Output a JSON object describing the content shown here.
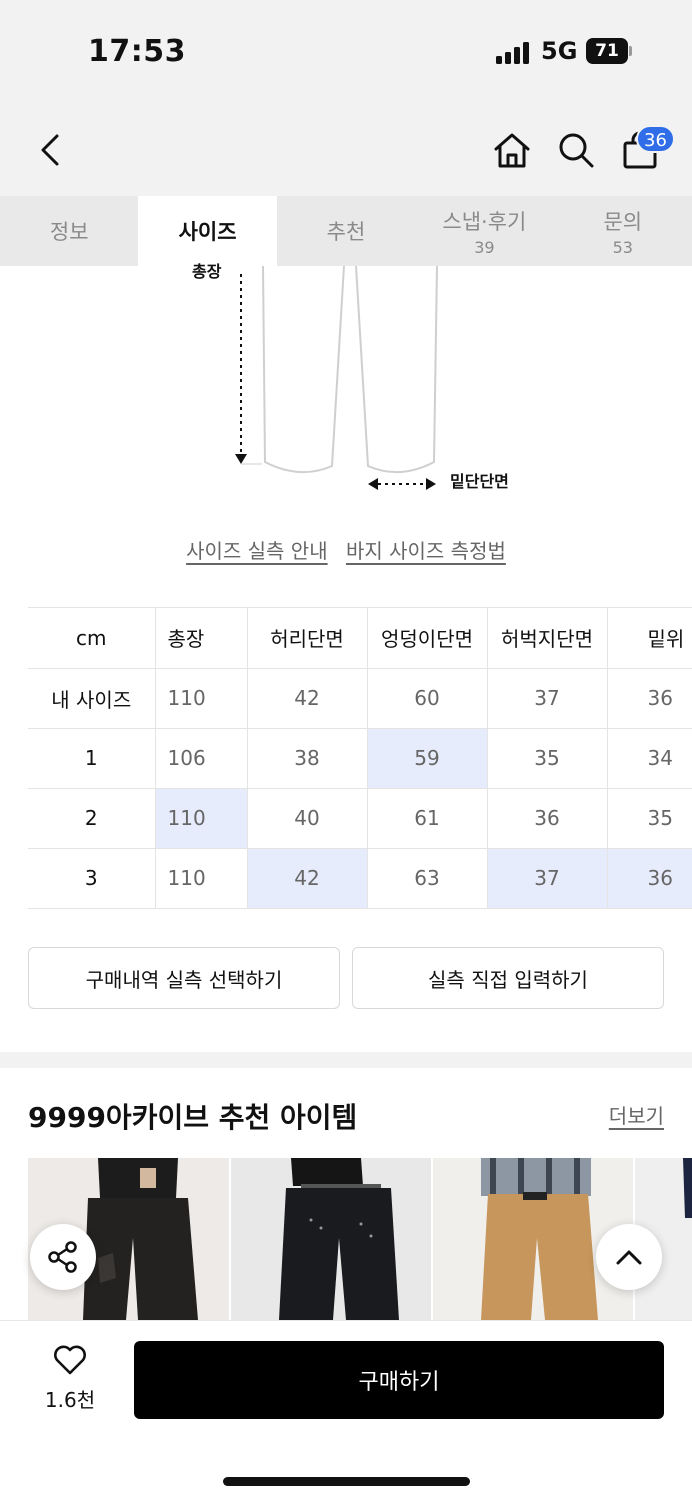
{
  "status": {
    "time": "17:53",
    "network": "5G",
    "battery": "71"
  },
  "header": {
    "cart_count": "36"
  },
  "tabs": [
    {
      "label": "정보",
      "count": ""
    },
    {
      "label": "사이즈",
      "count": ""
    },
    {
      "label": "추천",
      "count": ""
    },
    {
      "label": "스냅·후기",
      "count": "39"
    },
    {
      "label": "문의",
      "count": "53"
    }
  ],
  "diagram": {
    "length_label": "총장",
    "hem_label": "밑단단면"
  },
  "links": {
    "size_guide": "사이즈 실측 안내",
    "measure_guide": "바지 사이즈 측정법"
  },
  "size_table": {
    "headers": [
      "cm",
      "총장",
      "허리단면",
      "엉덩이단면",
      "허벅지단면",
      "밑위"
    ],
    "rows": [
      {
        "label": "내 사이즈",
        "values": [
          "110",
          "42",
          "60",
          "37",
          "36"
        ]
      },
      {
        "label": "1",
        "values": [
          "106",
          "38",
          "59",
          "35",
          "34"
        ]
      },
      {
        "label": "2",
        "values": [
          "110",
          "40",
          "61",
          "36",
          "35"
        ]
      },
      {
        "label": "3",
        "values": [
          "110",
          "42",
          "63",
          "37",
          "36"
        ]
      }
    ]
  },
  "actions": {
    "purchase_history": "구매내역 실측 선택하기",
    "direct_input": "실측 직접 입력하기"
  },
  "recommend": {
    "title": "9999아카이브 추천 아이템",
    "more": "더보기"
  },
  "bottom": {
    "like_count": "1.6천",
    "buy_label": "구매하기"
  },
  "colors": {
    "accent": "#2f6ee8",
    "highlight": "#e7ecfc"
  }
}
